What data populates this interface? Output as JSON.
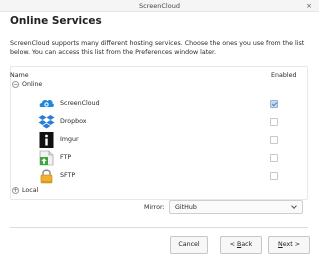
{
  "window": {
    "title": "ScreenCloud",
    "close_glyph": "×"
  },
  "heading": "Online Services",
  "description": "ScreenCloud supports many different hosting services. Choose the ones you use from the list below. You can access this list from the Preferences window later.",
  "table": {
    "columns": [
      "Name",
      "Enabled"
    ],
    "groups": [
      {
        "label": "Online",
        "expanded": true,
        "toggle": "−",
        "items": [
          {
            "name": "ScreenCloud",
            "icon": "screencloud-icon",
            "enabled": true
          },
          {
            "name": "Dropbox",
            "icon": "dropbox-icon",
            "enabled": false
          },
          {
            "name": "Imgur",
            "icon": "imgur-icon",
            "enabled": false
          },
          {
            "name": "FTP",
            "icon": "ftp-icon",
            "enabled": false
          },
          {
            "name": "SFTP",
            "icon": "sftp-icon",
            "enabled": false
          }
        ]
      },
      {
        "label": "Local",
        "expanded": false,
        "toggle": "+"
      }
    ]
  },
  "mirror": {
    "label": "Mirror:",
    "value": "GitHub"
  },
  "buttons": {
    "cancel": "Cancel",
    "back": {
      "lead": "< ",
      "mnemonic": "B",
      "rest": "ack"
    },
    "next": {
      "mnemonic": "N",
      "rest": "ext >"
    }
  },
  "colors": {
    "accent": "#1f88d8",
    "dropbox": "#2c7bd6",
    "check_on": "#c9d9ef"
  }
}
